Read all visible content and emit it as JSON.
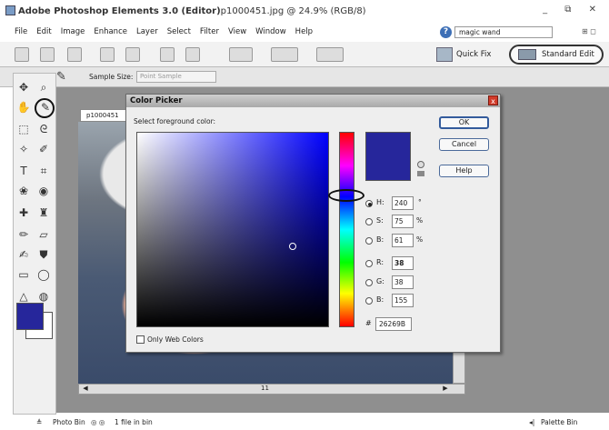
{
  "window": {
    "title": "Adobe Photoshop Elements 3.0 (Editor)",
    "document_title": "p1000451.jpg @ 24.9% (RGB/8)",
    "controls": "_ ⧉ ✕"
  },
  "menu": [
    "File",
    "Edit",
    "Image",
    "Enhance",
    "Layer",
    "Select",
    "Filter",
    "View",
    "Window",
    "Help"
  ],
  "help": {
    "icon": "?",
    "search_value": "magic wand"
  },
  "toolbar": {
    "quick_fix_label": "Quick Fix",
    "standard_edit_label": "Standard Edit"
  },
  "options_bar": {
    "sample_size_label": "Sample Size:",
    "sample_size_value": "Point Sample"
  },
  "document": {
    "tab_label": "p1000451",
    "scroll_center": "11"
  },
  "color_picker": {
    "title": "Color Picker",
    "close_glyph": "x",
    "prompt": "Select foreground color:",
    "ok_label": "OK",
    "cancel_label": "Cancel",
    "help_label": "Help",
    "fields": [
      {
        "label": "H:",
        "value": "240",
        "unit": "°",
        "selected": true
      },
      {
        "label": "S:",
        "value": "75",
        "unit": "%",
        "selected": false
      },
      {
        "label": "B:",
        "value": "61",
        "unit": "%",
        "selected": false
      },
      {
        "label": "R:",
        "value": "38",
        "unit": "",
        "selected": false
      },
      {
        "label": "G:",
        "value": "38",
        "unit": "",
        "selected": false
      },
      {
        "label": "B:",
        "value": "155",
        "unit": "",
        "selected": false
      }
    ],
    "hex_label": "#",
    "hex_value": "26269B",
    "web_only_label": "Only Web Colors",
    "selected_color": "#26269b"
  },
  "status": {
    "photo_bin": "Photo Bin",
    "file_count": "1 file in bin",
    "palette_bin": "Palette Bin"
  }
}
